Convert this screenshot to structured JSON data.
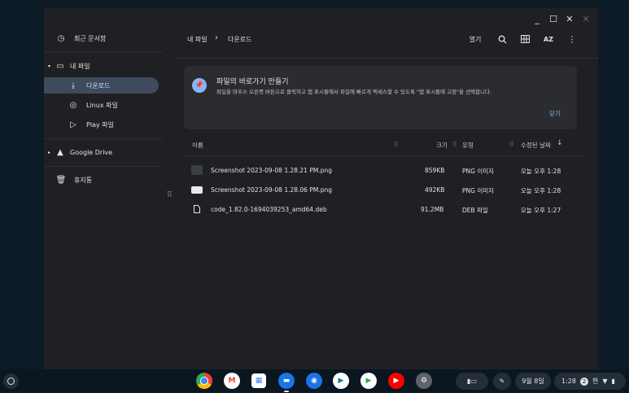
{
  "window_controls": {
    "minimize": "_",
    "maximize": "☐",
    "close": "✕",
    "close2": "✕"
  },
  "sidebar": {
    "recent": "최근 문서함",
    "my_files": "내 파일",
    "downloads": "다운로드",
    "linux_files": "Linux 파일",
    "play_files": "Play 파일",
    "google_drive": "Google Drive",
    "trash": "휴지통"
  },
  "breadcrumb": {
    "root": "내 파일",
    "separator": "›",
    "current": "다운로드"
  },
  "toolbar": {
    "open": "열기",
    "sort": "AZ"
  },
  "banner": {
    "title": "파일의 바로가기 만들기",
    "text": "파일을 마우스 오른쪽 버튼으로 클릭하고 앱 표시줄에서 파일에 빠르게 액세스할 수 있도록 \"앱 표시줄에 고정\"을 선택합니다.",
    "dismiss": "닫기"
  },
  "columns": {
    "name": "이름",
    "size": "크기",
    "type": "유형",
    "modified": "수정된 날짜"
  },
  "files": [
    {
      "name": "Screenshot 2023-09-08 1.28.21 PM.png",
      "size": "859KB",
      "type": "PNG 이미지",
      "modified": "오늘 오후 1:28",
      "icon": "image-thumb-icon"
    },
    {
      "name": "Screenshot 2023-09-08 1.28.06 PM.png",
      "size": "492KB",
      "type": "PNG 이미지",
      "modified": "오늘 오후 1:28",
      "icon": "image-thumb-icon"
    },
    {
      "name": "code_1.82.0-1694039253_amd64.deb",
      "size": "91.2MB",
      "type": "DEB 파일",
      "modified": "오늘 오후 1:27",
      "icon": "file-icon"
    }
  ],
  "shelf": {
    "date": "9월 8일",
    "time": "1:28",
    "notif_count": "2",
    "ime": "한"
  }
}
